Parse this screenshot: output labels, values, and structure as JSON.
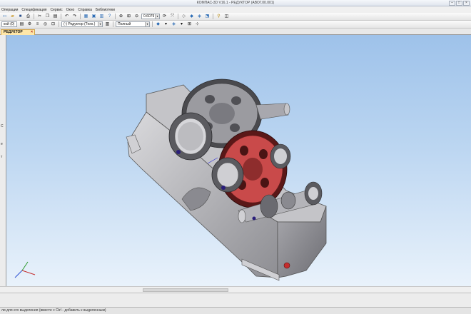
{
  "window": {
    "title": "КОМПАС-3D V16.1 - РЕДУКТОР (АВОГ.00.001)"
  },
  "menu": [
    "Операции",
    "Спецификация",
    "Сервис",
    "Окно",
    "Справка",
    "Библиотеки"
  ],
  "toolbar": {
    "zoom_value": "0.6079",
    "layer_label": "кой (0)",
    "component_combo": "(-) Редуктор (Техн.)",
    "display_combo": "Полный"
  },
  "document_tab": {
    "label": "РЕДУКТОР"
  },
  "left_panel": {
    "letters": [
      "С",
      "е",
      "т"
    ]
  },
  "status": {
    "text": "ли для его выделения (вместе с Ctrl - добавить к выделенным)"
  },
  "colors": {
    "viewport_top": "#9ec2ea",
    "gear_red": "#c94a4a",
    "housing_gray": "#b9b9bc"
  }
}
